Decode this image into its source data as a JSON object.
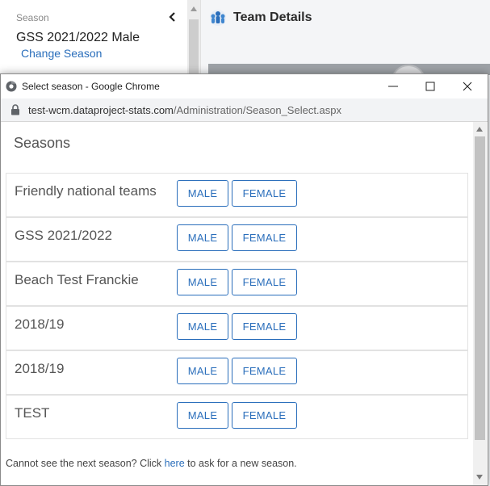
{
  "background": {
    "season_caption": "Season",
    "season_name": "GSS 2021/2022 Male",
    "change_season_link": "Change Season",
    "team_details_title": "Team Details"
  },
  "window": {
    "title": "Select season - Google Chrome",
    "url_host": "test-wcm.dataproject-stats.com",
    "url_path": "/Administration/Season_Select.aspx"
  },
  "page": {
    "heading": "Seasons",
    "seasons": [
      {
        "name": "Friendly national teams",
        "male_label": "MALE",
        "female_label": "FEMALE"
      },
      {
        "name": "GSS 2021/2022",
        "male_label": "MALE",
        "female_label": "FEMALE"
      },
      {
        "name": "Beach Test Franckie",
        "male_label": "MALE",
        "female_label": "FEMALE"
      },
      {
        "name": "2018/19",
        "male_label": "MALE",
        "female_label": "FEMALE"
      },
      {
        "name": "2018/19",
        "male_label": "MALE",
        "female_label": "FEMALE"
      },
      {
        "name": "TEST",
        "male_label": "MALE",
        "female_label": "FEMALE"
      }
    ],
    "footer_before": "Cannot see the next season? Click ",
    "footer_link": "here",
    "footer_after": " to ask for a new season."
  },
  "colors": {
    "accent": "#2a6ebb",
    "text_gray": "#555555"
  }
}
